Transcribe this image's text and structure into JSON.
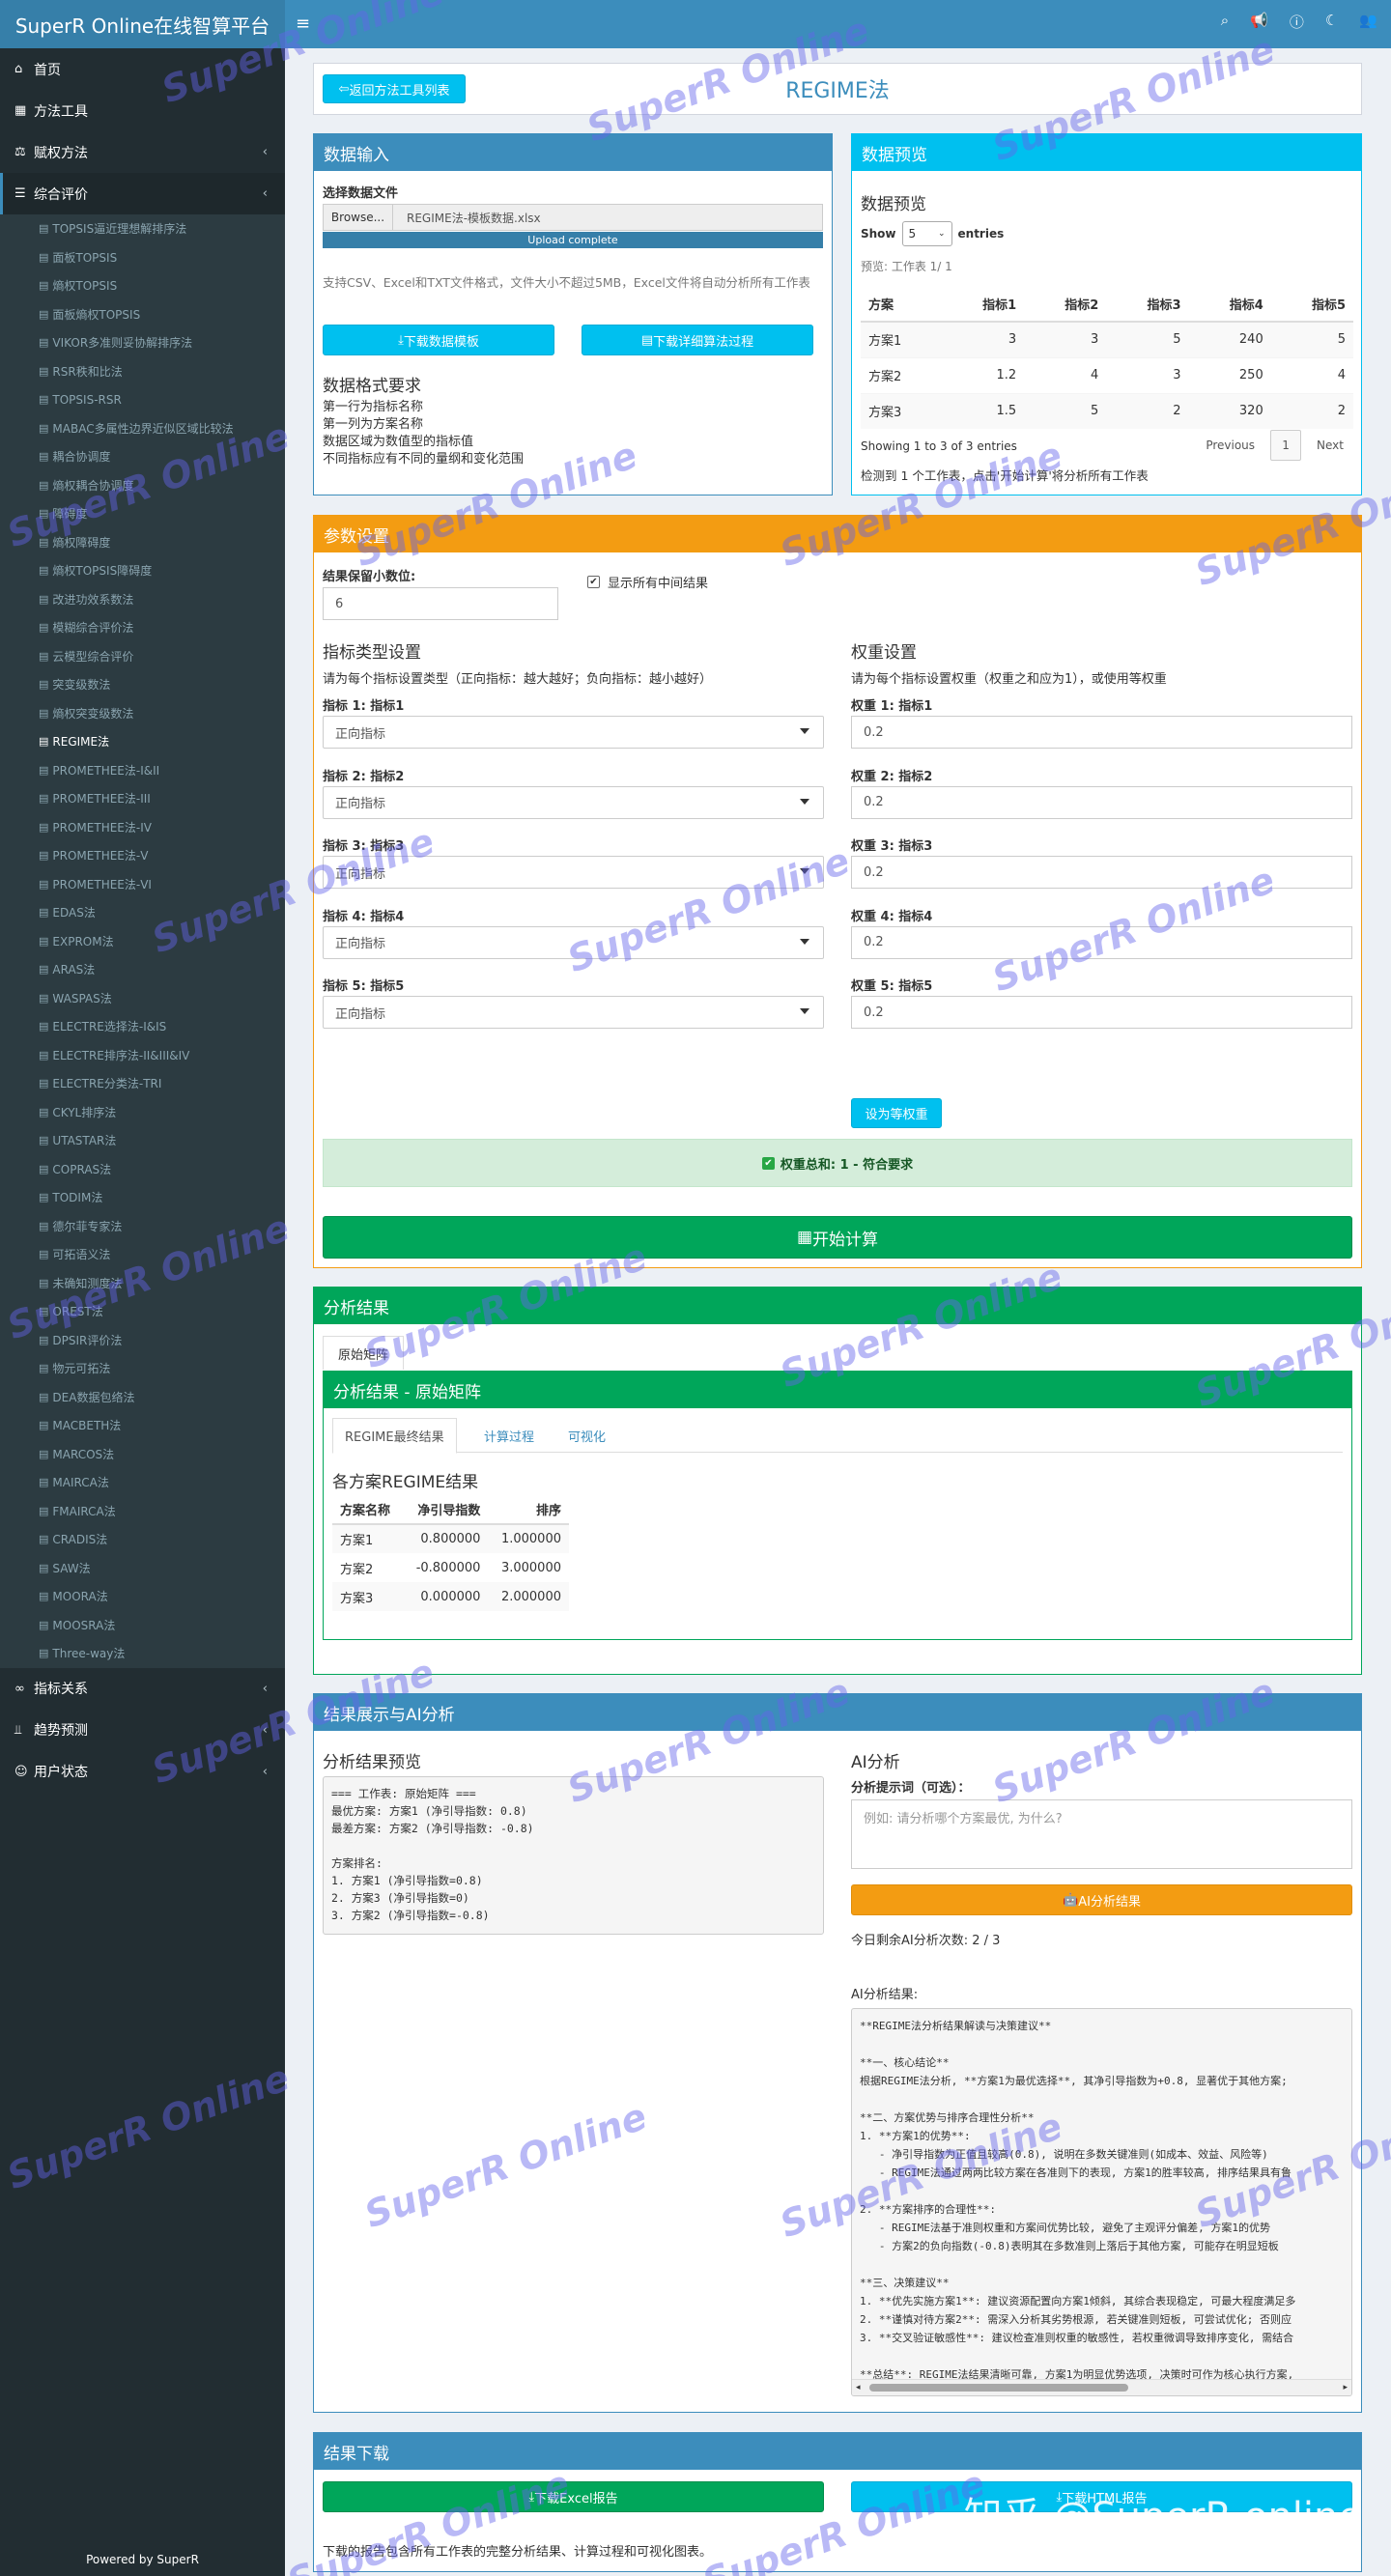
{
  "header": {
    "brand": "SuperR Online在线智算平台",
    "menu_icon": "bars-icon",
    "icons": [
      "search-icon",
      "bullhorn-icon",
      "question-circle-icon",
      "moon-icon",
      "users-icon"
    ]
  },
  "sidebar": {
    "items_top": [
      {
        "icon": "home-icon",
        "label": "首页"
      },
      {
        "icon": "table-icon",
        "label": "方法工具"
      },
      {
        "icon": "balance-icon",
        "label": "赋权方法"
      },
      {
        "icon": "list-icon",
        "label": "综合评价"
      }
    ],
    "sub_items": [
      "TOPSIS逼近理想解排序法",
      "面板TOPSIS",
      "熵权TOPSIS",
      "面板熵权TOPSIS",
      "VIKOR多准则妥协解排序法",
      "RSR秩和比法",
      "TOPSIS-RSR",
      "MABAC多属性边界近似区域比较法",
      "耦合协调度",
      "熵权耦合协调度",
      "障碍度",
      "熵权障碍度",
      "熵权TOPSIS障碍度",
      "改进功效系数法",
      "模糊综合评价法",
      "云模型综合评价",
      "突变级数法",
      "熵权突变级数法",
      "REGIME法",
      "PROMETHEE法-I&II",
      "PROMETHEE法-III",
      "PROMETHEE法-IV",
      "PROMETHEE法-V",
      "PROMETHEE法-VI",
      "EDAS法",
      "EXPROM法",
      "ARAS法",
      "WASPAS法",
      "ELECTRE选择法-I&IS",
      "ELECTRE排序法-II&III&IV",
      "ELECTRE分类法-TRI",
      "CKYL排序法",
      "UTASTAR法",
      "COPRAS法",
      "TODIM法",
      "德尔菲专家法",
      "可拓语义法",
      "未确知测度法",
      "OREST法",
      "DPSIR评价法",
      "物元可拓法",
      "DEA数据包络法",
      "MACBETH法",
      "MARCOS法",
      "MAIRCA法",
      "FMAIRCA法",
      "CRADIS法",
      "SAW法",
      "MOORA法",
      "MOOSRA法",
      "Three-way法"
    ],
    "current_sub": 18,
    "items_bottom": [
      {
        "icon": "link-icon",
        "label": "指标关系"
      },
      {
        "icon": "chart-icon",
        "label": "趋势预测"
      },
      {
        "icon": "user-icon",
        "label": "用户状态"
      }
    ],
    "footer": "Powered by SuperR"
  },
  "title_bar": {
    "back_button": "返回方法工具列表",
    "title": "REGIME法"
  },
  "data_input": {
    "header": "数据输入",
    "file_label": "选择数据文件",
    "browse": "Browse...",
    "file_name": "REGIME法-模板数据.xlsx",
    "upload_status": "Upload complete",
    "help": "支持CSV、Excel和TXT文件格式，文件大小不超过5MB，Excel文件将自动分析所有工作表",
    "btn_template": "下载数据模板",
    "btn_detail": "下载详细算法过程",
    "format_title": "数据格式要求",
    "format_lines": [
      "第一行为指标名称",
      "第一列为方案名称",
      "数据区域为数值型的指标值",
      "不同指标应有不同的量纲和变化范围"
    ]
  },
  "data_preview": {
    "header": "数据预览",
    "title": "数据预览",
    "show_label": "Show",
    "show_value": "5",
    "entries_label": "entries",
    "sheet_info": "预览: 工作表 1/ 1",
    "columns": [
      "方案",
      "指标1",
      "指标2",
      "指标3",
      "指标4",
      "指标5"
    ],
    "rows": [
      [
        "方案1",
        "3",
        "3",
        "5",
        "240",
        "5"
      ],
      [
        "方案2",
        "1.2",
        "4",
        "3",
        "250",
        "4"
      ],
      [
        "方案3",
        "1.5",
        "5",
        "2",
        "320",
        "2"
      ]
    ],
    "showing": "Showing 1 to 3 of 3 entries",
    "prev": "Previous",
    "page": "1",
    "next": "Next",
    "detect_note": "检测到 1 个工作表，点击'开始计算'将分析所有工作表"
  },
  "params": {
    "header": "参数设置",
    "decimals_label": "结果保留小数位:",
    "decimals_value": "6",
    "show_all_label": "显示所有中间结果",
    "indicator_title": "指标类型设置",
    "indicator_help": "请为每个指标设置类型（正向指标：越大越好；负向指标：越小越好）",
    "indicators": [
      {
        "label": "指标 1: 指标1",
        "value": "正向指标"
      },
      {
        "label": "指标 2: 指标2",
        "value": "正向指标"
      },
      {
        "label": "指标 3: 指标3",
        "value": "正向指标"
      },
      {
        "label": "指标 4: 指标4",
        "value": "正向指标"
      },
      {
        "label": "指标 5: 指标5",
        "value": "正向指标"
      }
    ],
    "weight_title": "权重设置",
    "weight_help": "请为每个指标设置权重（权重之和应为1），或使用等权重",
    "weights": [
      {
        "label": "权重 1: 指标1",
        "value": "0.2"
      },
      {
        "label": "权重 2: 指标2",
        "value": "0.2"
      },
      {
        "label": "权重 3: 指标3",
        "value": "0.2"
      },
      {
        "label": "权重 4: 指标4",
        "value": "0.2"
      },
      {
        "label": "权重 5: 指标5",
        "value": "0.2"
      }
    ],
    "equal_weight_btn": "设为等权重",
    "weight_sum": "权重总和: 1 - 符合要求",
    "start_btn": "开始计算"
  },
  "results": {
    "header": "分析结果",
    "tab": "原始矩阵",
    "inner_header": "分析结果 - 原始矩阵",
    "inner_tabs": [
      "REGIME最终结果",
      "计算过程",
      "可视化"
    ],
    "table_title": "各方案REGIME结果",
    "columns": [
      "方案名称",
      "净引导指数",
      "排序"
    ],
    "rows": [
      [
        "方案1",
        "0.800000",
        "1.000000"
      ],
      [
        "方案2",
        "-0.800000",
        "3.000000"
      ],
      [
        "方案3",
        "0.000000",
        "2.000000"
      ]
    ]
  },
  "ai": {
    "header": "结果展示与AI分析",
    "preview_title": "分析结果预览",
    "preview_text": "=== 工作表: 原始矩阵 ===\n最优方案: 方案1 (净引导指数: 0.8)\n最差方案: 方案2 (净引导指数: -0.8)\n\n方案排名:\n1. 方案1 (净引导指数=0.8)\n2. 方案3 (净引导指数=0)\n3. 方案2 (净引导指数=-0.8)",
    "ai_title": "AI分析",
    "prompt_label": "分析提示词（可选）：",
    "prompt_placeholder": "例如: 请分析哪个方案最优, 为什么?",
    "ai_btn": "AI分析结果",
    "remaining": "今日剩余AI分析次数: 2 / 3",
    "result_label": "AI分析结果:",
    "result_text": "**REGIME法分析结果解读与决策建议**\n\n**一、核心结论**\n根据REGIME法分析, **方案1为最优选择**, 其净引导指数为+0.8, 显著优于其他方案;\n\n**二、方案优势与排序合理性分析**\n1. **方案1的优势**:\n   - 净引导指数为正值且较高(0.8), 说明在多数关键准则(如成本、效益、风险等)\n   - REGIME法通过两两比较方案在各准则下的表现, 方案1的胜率较高, 排序结果具有鲁\n\n2. **方案排序的合理性**:\n   - REGIME法基于准则权重和方案间优势比较, 避免了主观评分偏差, 方案1的优势\n   - 方案2的负向指数(-0.8)表明其在多数准则上落后于其他方案, 可能存在明显短板\n\n**三、决策建议**\n1. **优先实施方案1**: 建议资源配置向方案1倾斜, 其综合表现稳定, 可最大程度满足多\n2. **谨慎对待方案2**: 需深入分析其劣势根源, 若关键准则短板, 可尝试优化; 否则应\n3. **交叉验证敏感性**: 建议检查准则权重的敏感性, 若权重微调导致排序变化, 需结合\n\n**总结**: REGIME法结果清晰可靠, 方案1为明显优势选项, 决策时可作为核心执行方案,"
  },
  "download": {
    "header": "结果下载",
    "excel_btn": "下载Excel报告",
    "html_btn": "下载HTML报告",
    "note": "下载的报告包含所有工作表的完整分析结果、计算过程和可视化图表。"
  },
  "watermark": {
    "text": "SuperR Online",
    "zhihu": "知乎 @SuperR online"
  }
}
